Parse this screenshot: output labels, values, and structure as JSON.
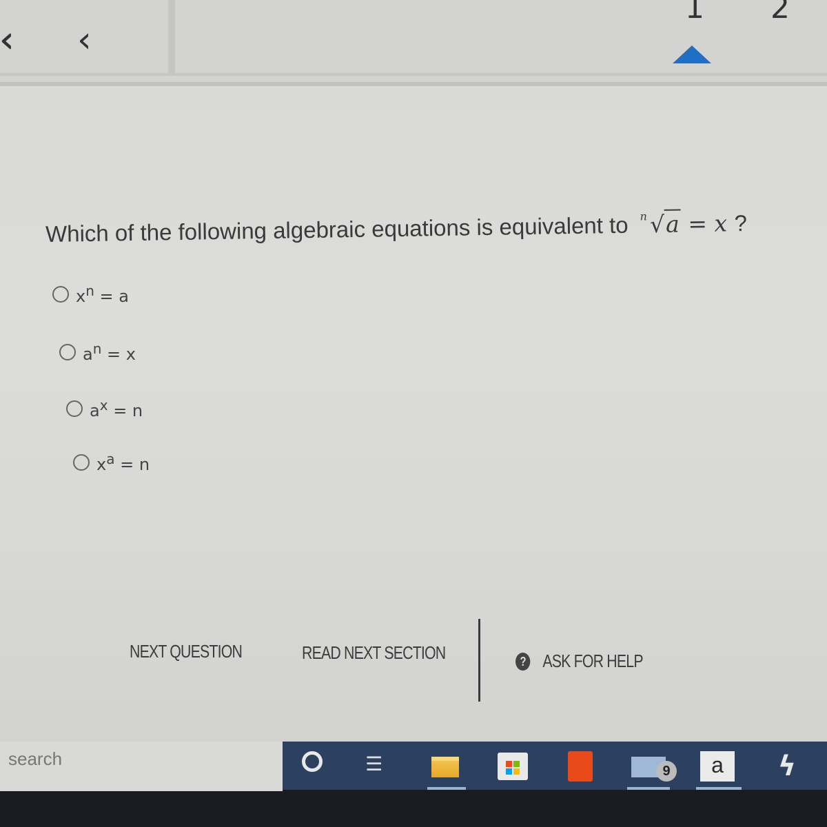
{
  "nav": {
    "first_glyph": "‹‹",
    "prev_glyph": "‹",
    "pages": [
      "1",
      "2"
    ],
    "current_page": "1"
  },
  "question": {
    "text": "Which of the following algebraic equations is equivalent to",
    "root_index": "n",
    "radicand": "a",
    "rhs": " = x",
    "question_mark": "?"
  },
  "options": [
    {
      "base": "x",
      "exp": "n",
      "rhs": " = a"
    },
    {
      "base": "a",
      "exp": "n",
      "rhs": " = x"
    },
    {
      "base": "a",
      "exp": "x",
      "rhs": " = n"
    },
    {
      "base": "x",
      "exp": "a",
      "rhs": " = n"
    }
  ],
  "actions": {
    "next_question": "NEXT QUESTION",
    "read_next_section": "READ NEXT SECTION",
    "ask_for_help": "ASK FOR HELP",
    "help_glyph": "?"
  },
  "taskbar": {
    "search_label": "search",
    "taskview_glyph": "☰",
    "mail_badge": "9",
    "amazon_glyph": "a",
    "bolt_glyph": "ϟ",
    "icons": [
      "cortana-icon",
      "task-view-icon",
      "file-explorer-icon",
      "store-icon",
      "office-icon",
      "mail-icon",
      "amazon-icon",
      "power-automate-icon"
    ]
  },
  "colors": {
    "page_indicator": "#1f6fc6",
    "taskbar": "#1a1c22",
    "taskbar_strip": "#2c4060",
    "office": "#e84a1a"
  }
}
